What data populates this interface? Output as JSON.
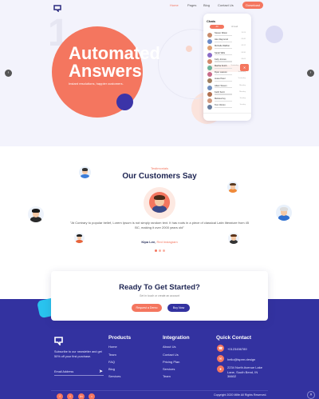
{
  "header": {
    "nav": [
      "Home",
      "Pages",
      "Blog",
      "Contact Us"
    ],
    "download_label": "Download"
  },
  "hero": {
    "number": "1",
    "title_line1": "Automated",
    "title_line2": "Answers",
    "subtitle": "Instant resolutions, happier customers."
  },
  "phone": {
    "title": "Chats",
    "tabs": [
      "All",
      "Unread"
    ],
    "contacts": [
      {
        "name": "Steven Nilson",
        "time": "10:24"
      },
      {
        "name": "Alex Raymond",
        "time": "09:40"
      },
      {
        "name": "Michelle Walther",
        "time": "09:12"
      },
      {
        "name": "Sarah Wills",
        "time": "08:30"
      },
      {
        "name": "Kelly Jonnes",
        "time": "08:05"
      },
      {
        "name": "Martha Smith",
        "time": "Yesterday"
      },
      {
        "name": "Ryan Lawson",
        "time": "Yesterday"
      },
      {
        "name": "Jesse Peter",
        "time": "Yesterday"
      },
      {
        "name": "Adam Steven",
        "time": "Monday"
      },
      {
        "name": "Keith Scott",
        "time": "Monday"
      },
      {
        "name": "Melissa Fey",
        "time": "Sunday"
      },
      {
        "name": "Tom Clinton",
        "time": "Sunday"
      }
    ]
  },
  "testimonials": {
    "kicker": "Testimonials",
    "heading": "Our Customers Say",
    "quote": "\"At Contrary to popular belief, Lorem Ipsum is not simply random text. It has roots in a piece of classical Latin literature from 45 BC, making it over 2000 years old\"",
    "author": "Kipo Lee,",
    "author_role": "Red Instagram"
  },
  "cta": {
    "heading": "Ready To Get Started?",
    "subtitle": "Get in touch or create an account",
    "demo_label": "Request a Demo",
    "buy_label": "Buy Now"
  },
  "footer": {
    "newsletter_text": "Subscribe to our newsletter and get 50% off your first purchase.",
    "email_placeholder": "Email Address",
    "products_title": "Products",
    "products": [
      "Home",
      "Team",
      "FAQ",
      "Blog",
      "Services"
    ],
    "integration_title": "Integration",
    "integration": [
      "About Us",
      "Contact Us",
      "Pricing Plan",
      "Services",
      "Team"
    ],
    "contact_title": "Quick Contact",
    "phone": "+0123456789",
    "email": "hello@lsprm.design",
    "address": "2234 North Avenue Lake Lane, South Bend, IN 36602",
    "copyright": "Copyright 2020 Mlife All Rights Reserved."
  },
  "colors": {
    "accent": "#f4765f",
    "brand": "#3332a0",
    "hero_bg": "#f3f3fc"
  }
}
